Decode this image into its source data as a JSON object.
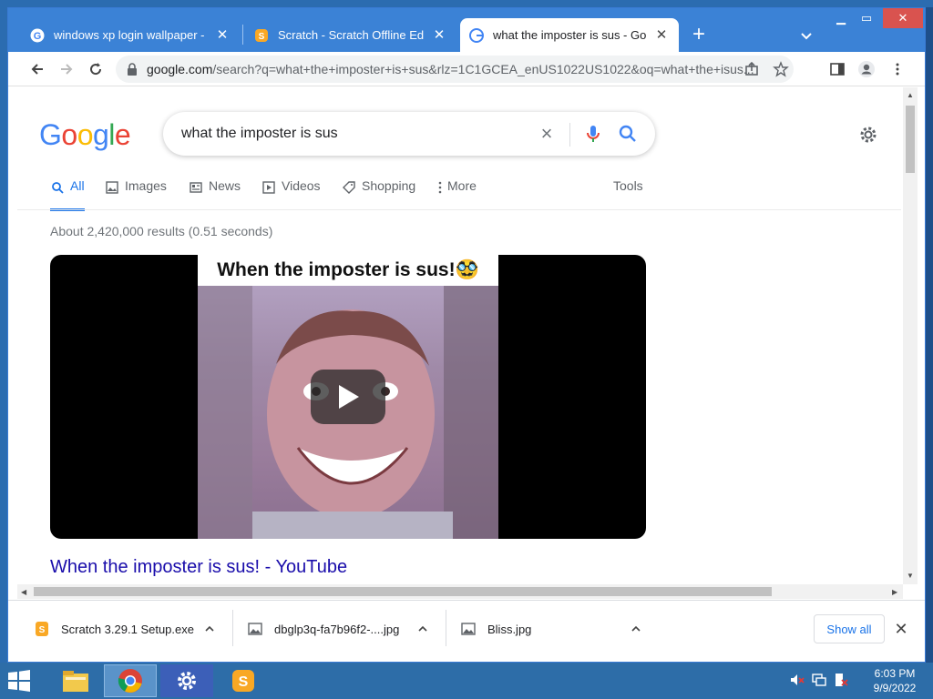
{
  "tabs": [
    {
      "title": "windows xp login wallpaper - Goo",
      "favicon": "google-icon",
      "active": false
    },
    {
      "title": "Scratch - Scratch Offline Editor",
      "favicon": "scratch-icon",
      "active": false
    },
    {
      "title": "what the imposter is sus - Googl",
      "favicon": "google-icon",
      "active": true
    }
  ],
  "toolbar": {
    "url_host": "google.com",
    "url_rest": "/search?q=what+the+imposter+is+sus&rlz=1C1GCEA_enUS1022US1022&oq=what+the+isus..."
  },
  "search": {
    "logo": "Google",
    "query": "what the imposter is sus",
    "tabs": [
      {
        "label": "All",
        "icon": "search-icon",
        "active": true
      },
      {
        "label": "Images",
        "icon": "image-icon",
        "active": false
      },
      {
        "label": "News",
        "icon": "news-icon",
        "active": false
      },
      {
        "label": "Videos",
        "icon": "play-icon",
        "active": false
      },
      {
        "label": "Shopping",
        "icon": "tag-icon",
        "active": false
      },
      {
        "label": "More",
        "icon": "dots-vertical-icon",
        "active": false
      }
    ],
    "tools_label": "Tools",
    "result_stats": "About 2,420,000 results (0.51 seconds)"
  },
  "result": {
    "video_caption": "When the imposter is sus!🥸",
    "title": "When the imposter is sus! - YouTube"
  },
  "downloads": {
    "items": [
      {
        "name": "Scratch 3.29.1 Setup.exe",
        "icon": "scratch-file-icon"
      },
      {
        "name": "dbglp3q-fa7b96f2-....jpg",
        "icon": "image-file-icon"
      },
      {
        "name": "Bliss.jpg",
        "icon": "image-file-icon"
      }
    ],
    "show_all": "Show all"
  },
  "taskbar": {
    "time": "6:03 PM",
    "date": "9/9/2022"
  },
  "colors": {
    "accent": "#1a73e8",
    "link": "#1a0dab",
    "titlebar": "#3b82d6",
    "taskbar": "#2d6da8"
  }
}
